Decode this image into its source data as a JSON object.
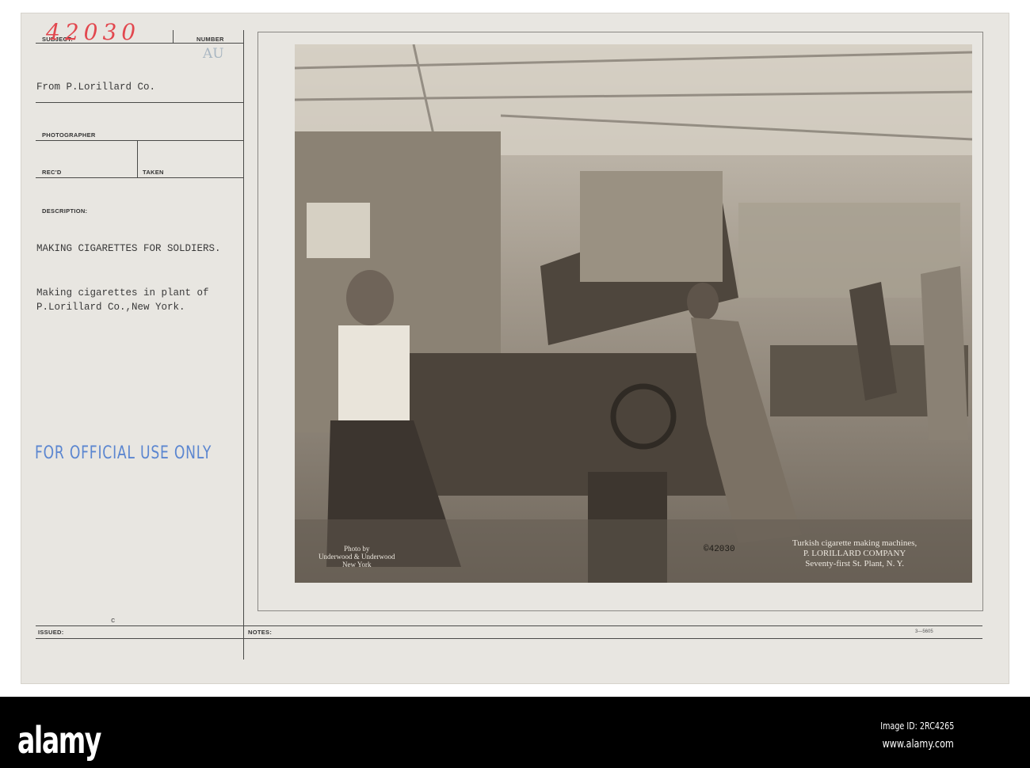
{
  "form": {
    "subject_label": "SUBJECT:",
    "subject_number": "42030",
    "number_label": "NUMBER",
    "number_value": "AU",
    "from": "From P.Lorillard Co.",
    "photographer_label": "PHOTOGRAPHER",
    "recd_label": "REC'D",
    "taken_label": "TAKEN",
    "description_label": "DESCRIPTION:",
    "title": "MAKING CIGARETTES FOR SOLDIERS.",
    "description_line1": "Making cigarettes in plant of",
    "description_line2": "P.Lorillard Co.,New York.",
    "stamp": "FOR OFFICIAL USE ONLY",
    "issued_label": "ISSUED:",
    "issued_mark": "c",
    "notes_label": "NOTES:",
    "form_code": "3—5605"
  },
  "photo": {
    "credit_line1": "Photo by",
    "credit_line2": "Underwood & Underwood",
    "credit_line3": "New York",
    "negative_number": "©42030",
    "caption_line1": "Turkish cigarette making machines,",
    "caption_line2": "P. LORILLARD COMPANY",
    "caption_line3": "Seventy-first St. Plant, N. Y."
  },
  "footer": {
    "logo": "alamy",
    "image_id": "Image ID: 2RC4265",
    "website": "www.alamy.com"
  }
}
